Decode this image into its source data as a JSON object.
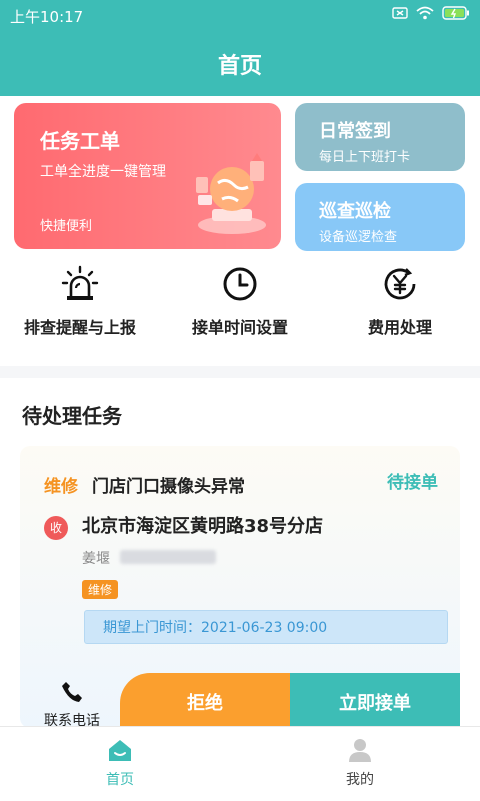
{
  "statusbar": {
    "time": "上午10:17"
  },
  "header": {
    "title": "首页"
  },
  "cards": {
    "task": {
      "title": "任务工单",
      "subtitle": "工单全进度一键管理",
      "footer": "快捷便利"
    },
    "checkin": {
      "title": "日常签到",
      "subtitle": "每日上下班打卡"
    },
    "patrol": {
      "title": "巡查巡检",
      "subtitle": "设备巡逻检查"
    }
  },
  "quick_actions": [
    {
      "label": "排查提醒与上报",
      "icon": "alarm-light-icon"
    },
    {
      "label": "接单时间设置",
      "icon": "clock-icon"
    },
    {
      "label": "费用处理",
      "icon": "yuan-coin-icon"
    }
  ],
  "pending": {
    "title": "待处理任务",
    "task": {
      "type": "维修",
      "title": "门店门口摄像头异常",
      "status": "待接单",
      "badge": "收",
      "address": "北京市海淀区黄明路38号分店",
      "contact_name": "姜堰",
      "tag": "维修",
      "expected_time": "期望上门时间：2021-06-23 09:00"
    },
    "actions": {
      "contact": "联系电话",
      "reject": "拒绝",
      "accept": "立即接单"
    }
  },
  "tabbar": {
    "home": "首页",
    "mine": "我的"
  },
  "colors": {
    "primary": "#3dbdb6",
    "orange": "#f59322",
    "red": "#ff6a70"
  }
}
